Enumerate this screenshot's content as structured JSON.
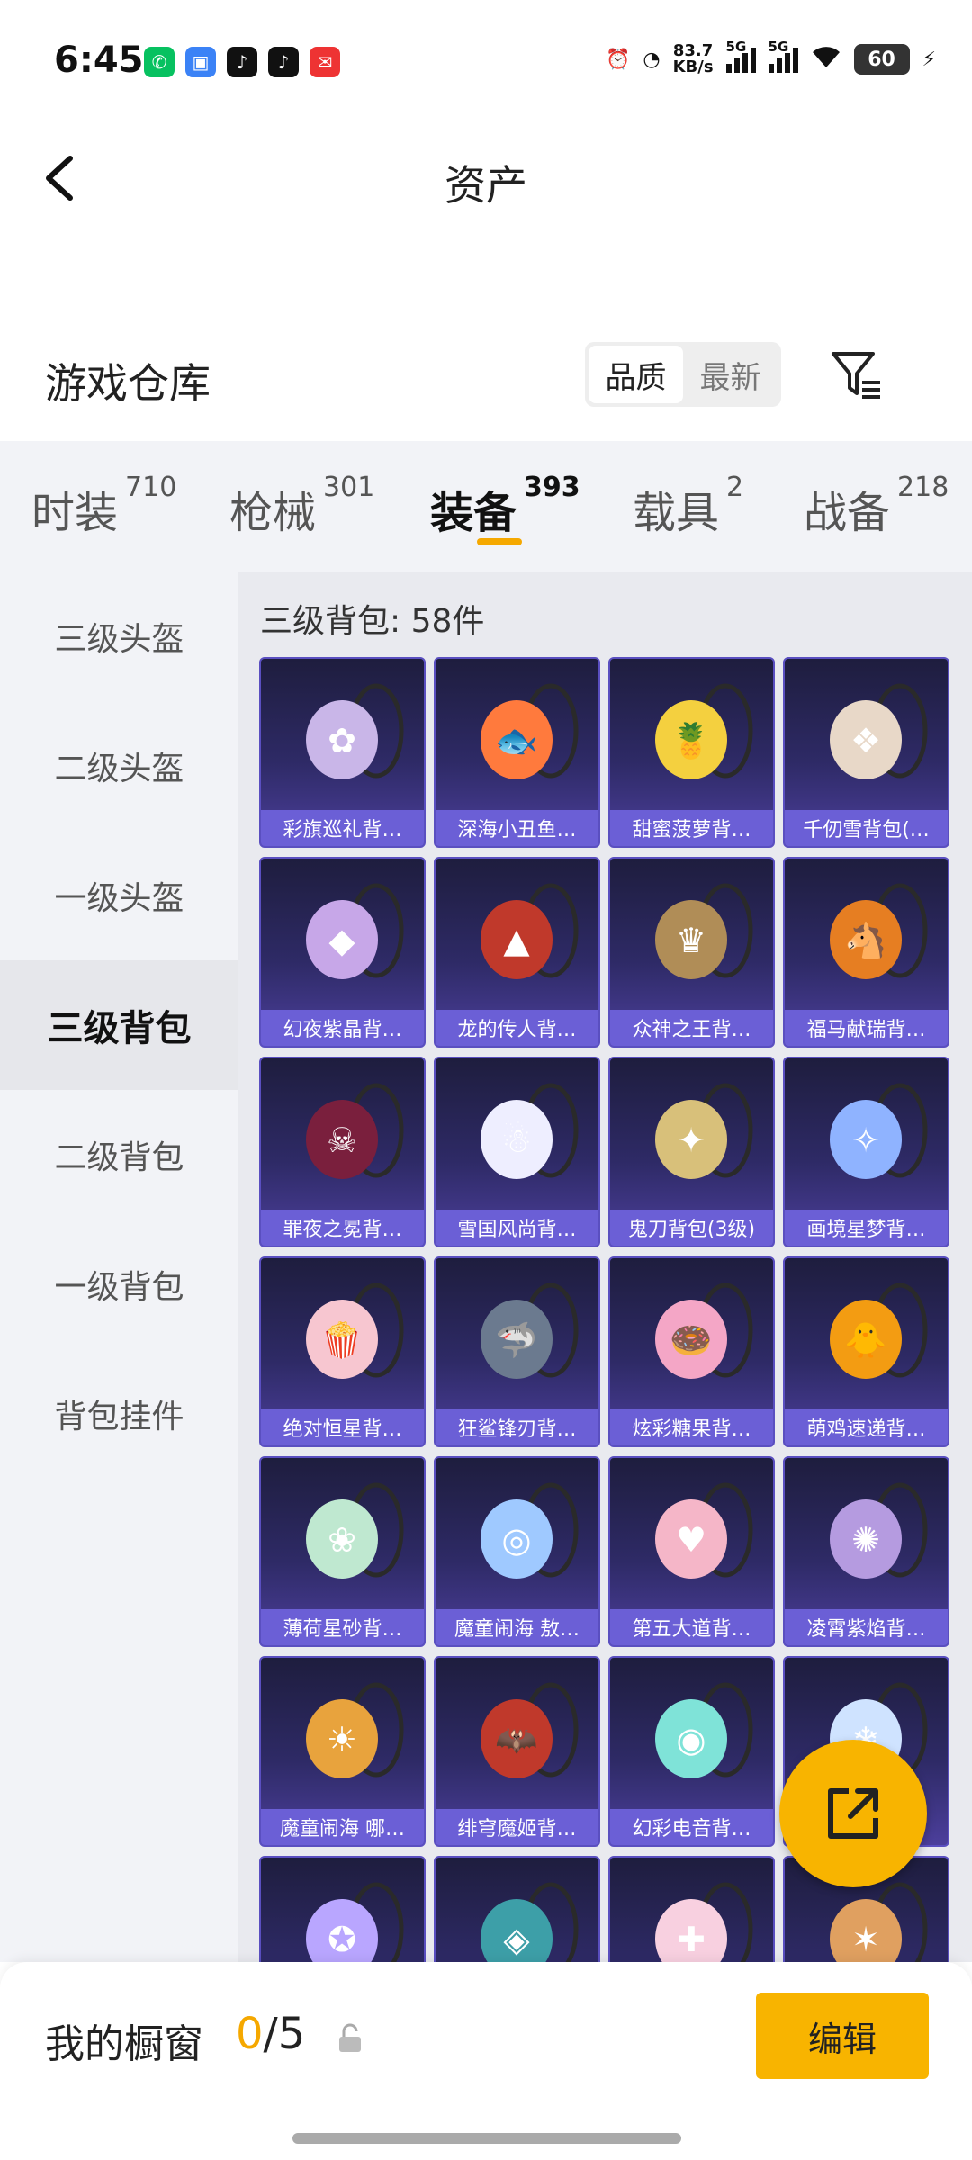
{
  "status": {
    "time": "6:45",
    "net_speed_value": "83.7",
    "net_speed_unit": "KB/s",
    "signal1": "5G",
    "signal2": "5G",
    "battery": "60"
  },
  "header": {
    "title": "资产"
  },
  "warehouse": {
    "title": "游戏仓库",
    "sort_quality": "品质",
    "sort_newest": "最新"
  },
  "tabs": [
    {
      "label": "时装",
      "count": "710"
    },
    {
      "label": "枪械",
      "count": "301"
    },
    {
      "label": "装备",
      "count": "393"
    },
    {
      "label": "载具",
      "count": "2"
    },
    {
      "label": "战备",
      "count": "218"
    }
  ],
  "sidebar": {
    "items": [
      "三级头盔",
      "二级头盔",
      "一级头盔",
      "三级背包",
      "二级背包",
      "一级背包",
      "背包挂件"
    ]
  },
  "content": {
    "header": "三级背包: 58件",
    "items": [
      "彩旗巡礼背…",
      "深海小丑鱼…",
      "甜蜜菠萝背…",
      "千仞雪背包(…",
      "幻夜紫晶背…",
      "龙的传人背…",
      "众神之王背…",
      "福马献瑞背…",
      "罪夜之冕背…",
      "雪国风尚背…",
      "鬼刀背包(3级)",
      "画境星梦背…",
      "绝对恒星背…",
      "狂鲨锋刃背…",
      "炫彩糖果背…",
      "萌鸡速递背…",
      "薄荷星砂背…",
      "魔童闹海 敖…",
      "第五大道背…",
      "凌霄紫焰背…",
      "魔童闹海 哪…",
      "绯穹魔姬背…",
      "幻彩电音背…",
      "",
      "",
      "",
      "",
      ""
    ]
  },
  "bottom": {
    "showcase_label": "我的橱窗",
    "showcase_current": "0",
    "showcase_total": "/5",
    "edit_label": "编辑"
  },
  "colors": {
    "accent": "#f8b400",
    "card_label_bg": "#6b5fd6"
  }
}
